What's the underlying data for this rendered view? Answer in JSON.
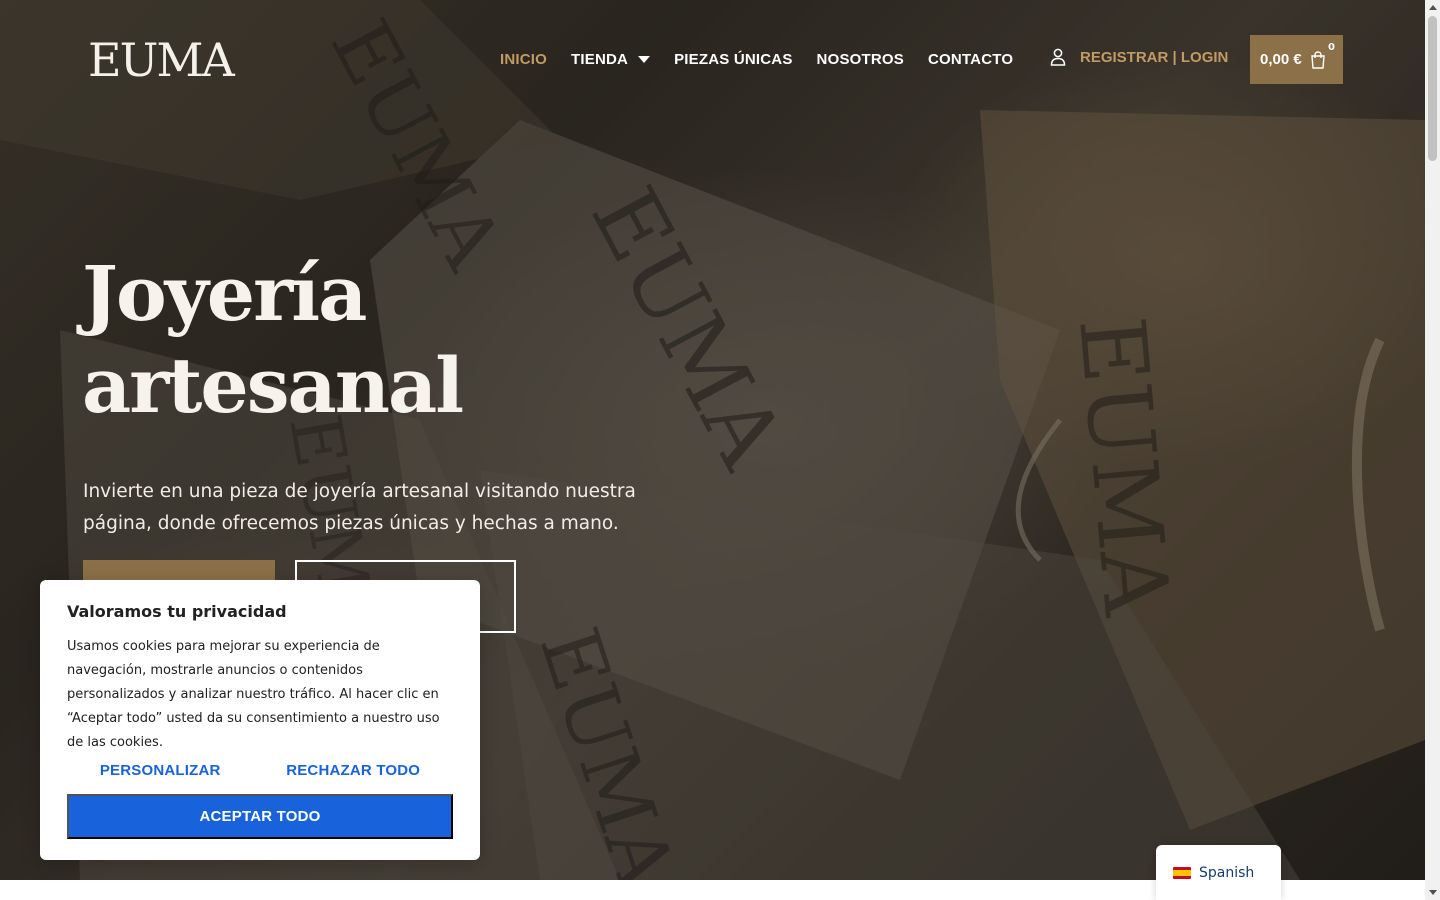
{
  "header": {
    "logo_text": "EUMA",
    "nav": [
      {
        "label": "INICIO",
        "active": true
      },
      {
        "label": "TIENDA",
        "has_dropdown": true
      },
      {
        "label": "PIEZAS ÚNICAS"
      },
      {
        "label": "NOSOTROS"
      },
      {
        "label": "CONTACTO"
      }
    ],
    "account_label": "REGISTRAR | LOGIN",
    "cart_total": "0,00 €",
    "cart_count": "0"
  },
  "hero": {
    "title_line1": "Joyería",
    "title_line2": "artesanal",
    "description": "Invierte en una pieza de joyería artesanal visitando nuestra página, donde ofrecemos piezas únicas y hechas a mano.",
    "background_words": [
      "EUMA",
      "EUMA",
      "EUMA",
      "EUMA",
      "EUMA"
    ]
  },
  "cookie_banner": {
    "title": "Valoramos tu privacidad",
    "text": "Usamos cookies para mejorar su experiencia de navegación, mostrarle anuncios o contenidos personalizados y analizar nuestro tráfico. Al hacer clic en “Aceptar todo” usted da su consentimiento a nuestro uso de las cookies.",
    "customize_label": "PERSONALIZAR",
    "reject_label": "RECHAZAR TODO",
    "accept_label": "ACEPTAR TODO"
  },
  "language_switcher": {
    "label": "Spanish",
    "flag": "spain-flag-icon"
  },
  "colors": {
    "accent": "#c39a62",
    "brand_button": "#8c7048",
    "cookie_blue": "#1863dc"
  }
}
